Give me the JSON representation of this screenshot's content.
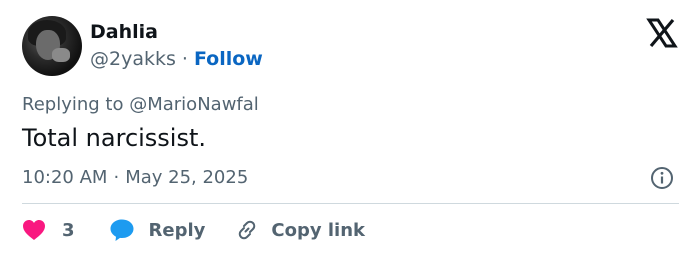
{
  "author": {
    "name": "Dahlia",
    "handle": "@2yakks",
    "separator": "·",
    "follow_label": "Follow"
  },
  "reply": {
    "prefix": "Replying to",
    "mention": "@MarioNawfal"
  },
  "tweet": {
    "text": "Total narcissist."
  },
  "meta": {
    "time": "10:20 AM",
    "separator": "·",
    "date": "May 25, 2025"
  },
  "actions": {
    "like_count": "3",
    "reply_label": "Reply",
    "copy_label": "Copy link"
  },
  "icons": {
    "logo": "x-logo-icon",
    "info": "info-icon",
    "like": "heart-icon",
    "reply": "speech-bubble-icon",
    "copy": "link-icon"
  },
  "colors": {
    "heart": "#f91880",
    "reply_bubble": "#1d9bf0",
    "follow": "#0a66c2",
    "muted_text": "#536471",
    "primary_text": "#0f1419"
  }
}
